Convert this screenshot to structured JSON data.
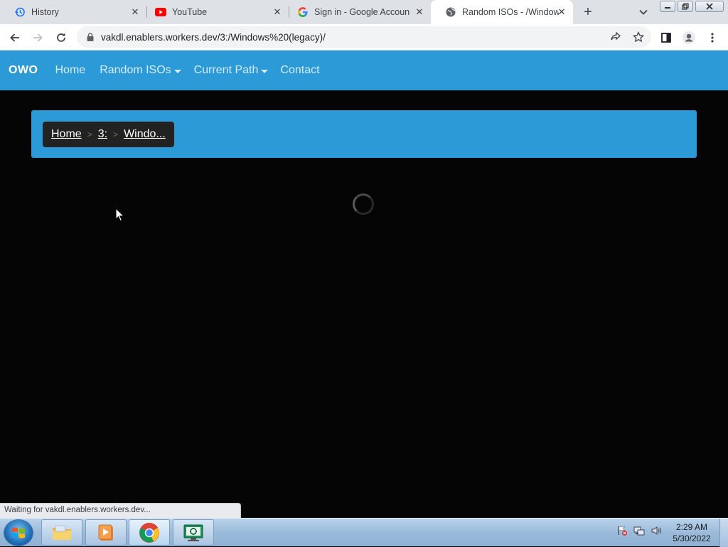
{
  "browser": {
    "tabs": [
      {
        "title": "History",
        "icon": "history-icon",
        "active": false
      },
      {
        "title": "YouTube",
        "icon": "youtube-icon",
        "active": false
      },
      {
        "title": "Sign in - Google Accounts",
        "icon": "google-icon",
        "active": false
      },
      {
        "title": "Random ISOs - /Windows",
        "icon": "globe-icon",
        "active": true
      }
    ],
    "url": "vakdl.enablers.workers.dev/3:/Windows%20(legacy)/",
    "status_text": "Waiting for vakdl.enablers.workers.dev..."
  },
  "site": {
    "brand": "OWO",
    "nav": [
      {
        "label": "Home",
        "dropdown": false
      },
      {
        "label": "Random ISOs",
        "dropdown": true
      },
      {
        "label": "Current Path",
        "dropdown": true
      },
      {
        "label": "Contact",
        "dropdown": false
      }
    ],
    "breadcrumb": [
      {
        "label": "Home"
      },
      {
        "label": "3:"
      },
      {
        "label": "Windo..."
      }
    ],
    "breadcrumb_separator": ">"
  },
  "taskbar": {
    "apps": [
      "explorer-icon",
      "media-player-icon",
      "chrome-icon",
      "remote-desktop-icon"
    ],
    "time": "2:29 AM",
    "date": "5/30/2022"
  },
  "colors": {
    "accent": "#2c9ad6",
    "page_bg": "#050505",
    "breadcrumb_bg": "#222222"
  }
}
